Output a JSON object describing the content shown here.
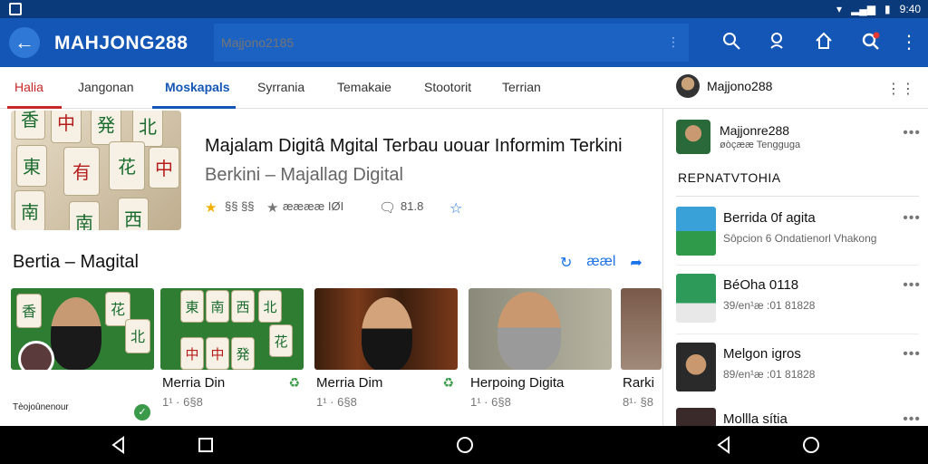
{
  "status_bar": {
    "time": "9:40"
  },
  "app_bar": {
    "brand": "MAHJONG288",
    "search_placeholder": "Majjono2185"
  },
  "tabs": [
    {
      "label": "Halia"
    },
    {
      "label": "Jangonan"
    },
    {
      "label": "Moskapals"
    },
    {
      "label": "Syrrania"
    },
    {
      "label": "Temakaie"
    },
    {
      "label": "Stootorit"
    },
    {
      "label": "Terrian"
    }
  ],
  "tab_profile": {
    "name": "Majjono288"
  },
  "featured": {
    "headline": "Majalam Digitâ Mgital Terbau uouar Informim Terkini",
    "subhead": "Berkini – Majallag Digital",
    "rating": "§§ §§",
    "rating2": "★★★★",
    "rating2_text": "ææææ IØI",
    "comments": "81.8"
  },
  "section": {
    "title": "Bertia – Magital",
    "action_label": "ææl"
  },
  "cards": [
    {
      "title": "",
      "date": "",
      "caption": "Tèojoûnenour"
    },
    {
      "title": "Merria Din",
      "date": "1¹ · 6§8"
    },
    {
      "title": "Merria Dim",
      "date": "1¹ · 6§8"
    },
    {
      "title": "Herpoing Digita",
      "date": "1¹ · 6§8"
    },
    {
      "title": "Rarki",
      "date": "8¹· §8"
    }
  ],
  "sidebar": {
    "profile_name": "Majjonre288",
    "profile_sub": "øòçææ Tengguga",
    "section_title": "REPNATVTOHIA",
    "items": [
      {
        "title": "Berrida 0f agita",
        "sub": "Sôpcion 6 Ondatienorl Vhakong"
      },
      {
        "title": "BéOha 0118",
        "sub": "39/en¹æ :01 81828"
      },
      {
        "title": "Melgon igros",
        "sub": "89/en¹æ :01 81828"
      },
      {
        "title": "Mollla sítia",
        "sub": ""
      }
    ]
  },
  "colors": {
    "status_bar": "#0b3a7a",
    "app_bar": "#1456b5",
    "active_tab_red": "#c62828",
    "active_tab_blue": "#1456b5",
    "accent": "#1a73e8"
  }
}
